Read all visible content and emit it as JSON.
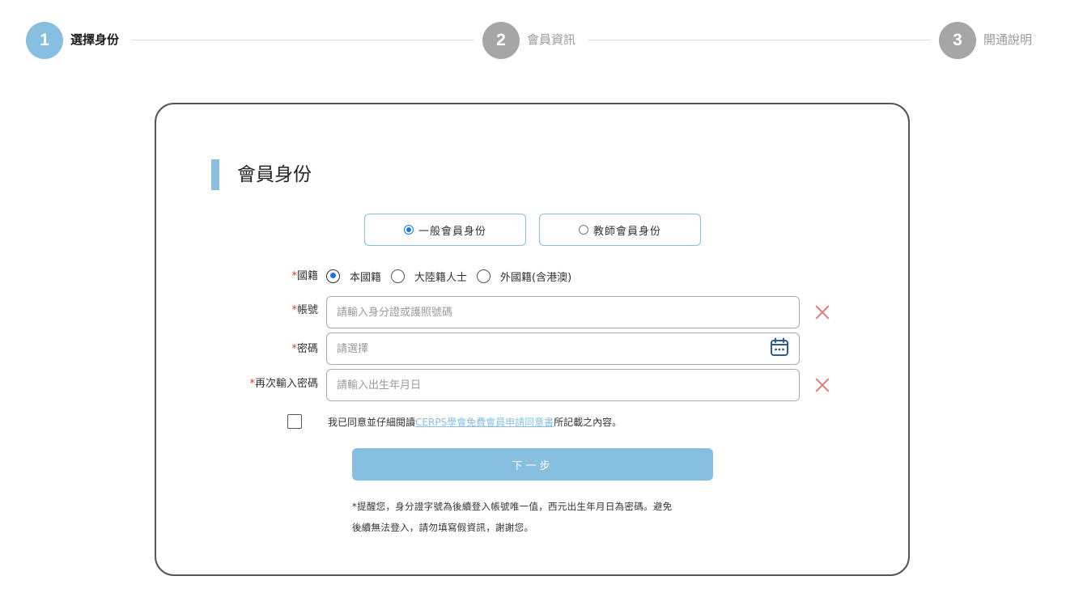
{
  "stepper": {
    "steps": [
      {
        "number": "1",
        "label": "選擇身份",
        "active": true
      },
      {
        "number": "2",
        "label": "會員資訊",
        "active": false
      },
      {
        "number": "3",
        "label": "開通說明",
        "active": false
      }
    ]
  },
  "section": {
    "title": "會員身份"
  },
  "member_type": {
    "options": [
      {
        "label": "一般會員身份",
        "selected": true
      },
      {
        "label": "教師會員身份",
        "selected": false
      }
    ]
  },
  "form": {
    "required_mark": "*",
    "nationality": {
      "label": "國籍",
      "options": [
        {
          "label": "本國籍",
          "selected": true
        },
        {
          "label": "大陸籍人士",
          "selected": false
        },
        {
          "label": "外國籍(含港澳)",
          "selected": false
        }
      ]
    },
    "account": {
      "label": "帳號",
      "placeholder": "請輸入身分證或護照號碼"
    },
    "password": {
      "label": "密碼",
      "placeholder": "請選擇"
    },
    "confirm_password": {
      "label": "再次輸入密碼",
      "placeholder": "請輸入出生年月日"
    }
  },
  "agreement": {
    "prefix": "我已同意並仔細閱讀",
    "link": "CERPS學會免費會員申請同意書",
    "suffix": "所記載之內容。"
  },
  "next_button": {
    "label": "下一步"
  },
  "note": {
    "line1": "*提醒您，身分證字號為後續登入帳號唯一值，西元出生年月日為密碼。避免",
    "line2": "後續無法登入，請勿填寫假資訊，謝謝您。"
  },
  "colors": {
    "accent": "#86bfe0",
    "inactive_step": "#a6a6a6",
    "required": "#e53935",
    "clear_icon": "#e07b7b",
    "calendar_icon": "#2a5d8f"
  }
}
